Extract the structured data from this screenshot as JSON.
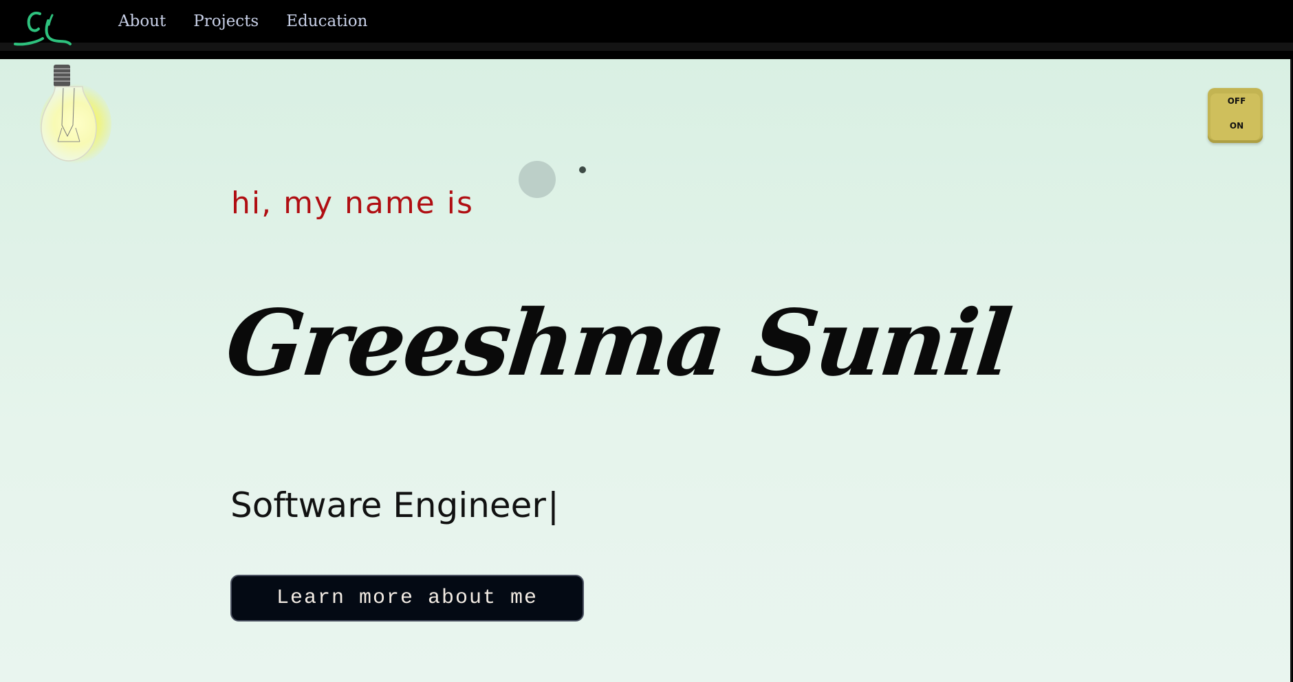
{
  "nav": {
    "links": [
      "About",
      "Projects",
      "Education"
    ]
  },
  "hero": {
    "greeting": "hi, my name is",
    "name": "Greeshma Sunil",
    "role": "Software Engineer",
    "cursor": "|",
    "cta_label": "Learn more about me"
  },
  "light_switch": {
    "off_label": "OFF",
    "on_label": "ON"
  },
  "colors": {
    "accent_red": "#b00e12",
    "logo_green": "#2ec27e",
    "background_mint": "#d9f0e3",
    "switch_gold": "#c3b452"
  },
  "icons": {
    "logo": "gs-monogram-logo",
    "bulb": "lightbulb-icon"
  }
}
